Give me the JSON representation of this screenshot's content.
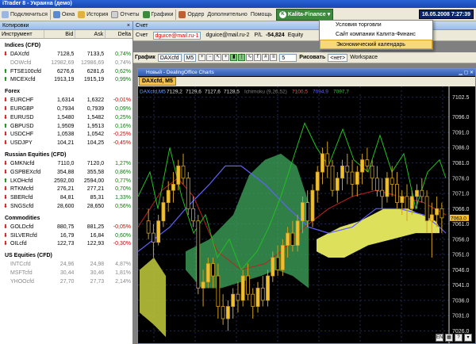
{
  "window_title": "iTrader 8 - Украина (демо)",
  "toolbar": {
    "items": [
      "Подключиться",
      "Окна",
      "История",
      "Отчеты",
      "Графики",
      "Ордер",
      "Дополнительно",
      "Помощь"
    ],
    "brand": "Kalita-Finance",
    "datetime": "16.05.2008 7:27:39"
  },
  "dropdown": {
    "items": [
      "Условия торговли",
      "Сайт компании Калита-Финанс",
      "Экономический календарь"
    ]
  },
  "quotes_panel": {
    "title": "Котировки",
    "columns": [
      "Инструмент",
      "Bid",
      "Ask",
      "Delta"
    ],
    "groups": [
      {
        "name": "Indices (CFD)",
        "rows": [
          {
            "sym": "DAXcfd",
            "bid": "7128,5",
            "ask": "7133,5",
            "delta": "0,74%",
            "dir": "up"
          },
          {
            "sym": "DOWcfd",
            "bid": "12982,69",
            "ask": "12986,69",
            "delta": "0,74%",
            "dir": "muted"
          },
          {
            "sym": "FTSE100cfd",
            "bid": "6276,6",
            "ask": "6281,6",
            "delta": "0,62%",
            "dir": "dn"
          },
          {
            "sym": "MICEXcfd",
            "bid": "1913,19",
            "ask": "1915,19",
            "delta": "0,99%",
            "dir": "dn"
          }
        ]
      },
      {
        "name": "Forex",
        "rows": [
          {
            "sym": "EURCHF",
            "bid": "1,6314",
            "ask": "1,6322",
            "delta": "-0,01%",
            "dir": "up"
          },
          {
            "sym": "EURGBP",
            "bid": "0,7934",
            "ask": "0,7939",
            "delta": "0,09%",
            "dir": "up"
          },
          {
            "sym": "EURUSD",
            "bid": "1,5480",
            "ask": "1,5482",
            "delta": "0,25%",
            "dir": "up"
          },
          {
            "sym": "GBPUSD",
            "bid": "1,9509",
            "ask": "1,9513",
            "delta": "0,16%",
            "dir": "dn"
          },
          {
            "sym": "USDCHF",
            "bid": "1,0538",
            "ask": "1,0542",
            "delta": "-0,25%",
            "dir": "up"
          },
          {
            "sym": "USDJPY",
            "bid": "104,21",
            "ask": "104,25",
            "delta": "-0,45%",
            "dir": "up"
          }
        ]
      },
      {
        "name": "Russian Equities (CFD)",
        "rows": [
          {
            "sym": "GMKNcfd",
            "bid": "7110,0",
            "ask": "7120,0",
            "delta": "1,27%",
            "dir": "up"
          },
          {
            "sym": "GSPBEXcfd",
            "bid": "354,88",
            "ask": "355,58",
            "delta": "0,86%",
            "dir": "up"
          },
          {
            "sym": "LKOHcfd",
            "bid": "2592,00",
            "ask": "2594,00",
            "delta": "0,77%",
            "dir": "dn"
          },
          {
            "sym": "RTKMcfd",
            "bid": "276,21",
            "ask": "277,21",
            "delta": "0,70%",
            "dir": "up"
          },
          {
            "sym": "SBERcfd",
            "bid": "84,81",
            "ask": "85,31",
            "delta": "1,33%",
            "dir": "up"
          },
          {
            "sym": "SNGScfd",
            "bid": "28,600",
            "ask": "28,650",
            "delta": "0,56%",
            "dir": "up"
          }
        ]
      },
      {
        "name": "Commodities",
        "rows": [
          {
            "sym": "GOLDcfd",
            "bid": "880,75",
            "ask": "881,25",
            "delta": "-0,05%",
            "dir": "up"
          },
          {
            "sym": "SILVERcfd",
            "bid": "16,79",
            "ask": "16,84",
            "delta": "0,60%",
            "dir": "up"
          },
          {
            "sym": "OILcfd",
            "bid": "122,73",
            "ask": "122,93",
            "delta": "-0,30%",
            "dir": "up"
          }
        ]
      },
      {
        "name": "US Equities (CFD)",
        "rows": [
          {
            "sym": "INTCcfd",
            "bid": "24,96",
            "ask": "24,98",
            "delta": "4,87%",
            "dir": "muted"
          },
          {
            "sym": "MSFTcfd",
            "bid": "30,44",
            "ask": "30,46",
            "delta": "1,81%",
            "dir": "muted"
          },
          {
            "sym": "YHOOcfd",
            "bid": "27,70",
            "ask": "27,73",
            "delta": "2,14%",
            "dir": "muted"
          }
        ]
      }
    ]
  },
  "account": {
    "title": "Счет",
    "label": "Счет",
    "login_a": "dguice@mail.ru-1",
    "login_b": "dguice@mail.ru-2",
    "pl_label": "P/L",
    "pl_value": "-54,824",
    "equity_label": "Equity"
  },
  "chart_toolbar": {
    "chart_label": "График",
    "symbol": "DAXcfd",
    "timeframe": "M5",
    "period": "5",
    "draw_label": "Рисовать",
    "none_option": "<нет>",
    "workspace": "Workspace"
  },
  "chart_window": {
    "title": "Новый - DealingOffice Charts",
    "tab": "DAXcfd, M5",
    "ohlc": [
      "7129,2",
      "7129,6",
      "7127,6",
      "7128,5"
    ],
    "extra": [
      "7100,5",
      "7094,9",
      "7097,7"
    ],
    "header_label": "DAXcfd,M5",
    "ichimoku_label": "Ichimoku (9,26,52)",
    "mini_icons": [
      "EN",
      "?"
    ]
  },
  "chart_data": {
    "type": "line",
    "yticks": [
      "7102.5",
      "7096.0",
      "7091.0",
      "7086.0",
      "7081.0",
      "7076.0",
      "7071.0",
      "7066.0",
      "7061.0",
      "7056.0",
      "7051.0",
      "7046.0",
      "7041.0",
      "7036.0",
      "7031.0",
      "7026.0"
    ],
    "ylim": [
      7023,
      7105
    ],
    "last_price": "7063.0",
    "candles": [
      [
        7062,
        7066,
        7056,
        7058
      ],
      [
        7058,
        7061,
        7050,
        7055
      ],
      [
        7055,
        7064,
        7054,
        7062
      ],
      [
        7062,
        7070,
        7060,
        7068
      ],
      [
        7068,
        7075,
        7065,
        7072
      ],
      [
        7072,
        7078,
        7068,
        7074
      ],
      [
        7074,
        7082,
        7072,
        7080
      ],
      [
        7080,
        7084,
        7074,
        7076
      ],
      [
        7076,
        7078,
        7064,
        7066
      ],
      [
        7066,
        7070,
        7060,
        7062
      ],
      [
        7062,
        7064,
        7038,
        7040
      ],
      [
        7040,
        7046,
        7034,
        7042
      ],
      [
        7042,
        7050,
        7040,
        7048
      ],
      [
        7048,
        7050,
        7040,
        7044
      ],
      [
        7044,
        7048,
        7030,
        7034
      ],
      [
        7034,
        7038,
        7028,
        7030
      ],
      [
        7030,
        7036,
        7026,
        7034
      ],
      [
        7034,
        7040,
        7030,
        7038
      ],
      [
        7038,
        7042,
        7032,
        7036
      ],
      [
        7036,
        7046,
        7034,
        7044
      ],
      [
        7044,
        7048,
        7036,
        7038
      ],
      [
        7038,
        7040,
        7030,
        7034
      ],
      [
        7034,
        7042,
        7032,
        7040
      ],
      [
        7040,
        7044,
        7034,
        7036
      ],
      [
        7036,
        7046,
        7034,
        7044
      ],
      [
        7044,
        7052,
        7042,
        7050
      ],
      [
        7050,
        7054,
        7044,
        7046
      ],
      [
        7046,
        7056,
        7044,
        7054
      ],
      [
        7054,
        7060,
        7050,
        7058
      ],
      [
        7058,
        7062,
        7052,
        7054
      ],
      [
        7054,
        7064,
        7052,
        7062
      ],
      [
        7062,
        7070,
        7058,
        7068
      ],
      [
        7068,
        7072,
        7060,
        7062
      ],
      [
        7062,
        7074,
        7060,
        7072
      ],
      [
        7072,
        7080,
        7068,
        7078
      ],
      [
        7078,
        7086,
        7074,
        7084
      ],
      [
        7084,
        7088,
        7076,
        7080
      ],
      [
        7080,
        7082,
        7070,
        7072
      ],
      [
        7072,
        7078,
        7068,
        7076
      ],
      [
        7076,
        7082,
        7072,
        7080
      ],
      [
        7080,
        7084,
        7074,
        7078
      ],
      [
        7078,
        7082,
        7070,
        7074
      ],
      [
        7074,
        7080,
        7070,
        7078
      ],
      [
        7078,
        7084,
        7074,
        7082
      ],
      [
        7082,
        7086,
        7078,
        7080
      ],
      [
        7080,
        7082,
        7072,
        7076
      ],
      [
        7076,
        7080,
        7070,
        7072
      ],
      [
        7072,
        7076,
        7066,
        7070
      ],
      [
        7070,
        7078,
        7068,
        7076
      ],
      [
        7076,
        7080,
        7070,
        7074
      ],
      [
        7074,
        7078,
        7066,
        7068
      ],
      [
        7068,
        7072,
        7064,
        7070
      ],
      [
        7070,
        7074,
        7062,
        7066
      ],
      [
        7066,
        7072,
        7064,
        7070
      ],
      [
        7070,
        7074,
        7066,
        7072
      ],
      [
        7072,
        7076,
        7068,
        7070
      ],
      [
        7070,
        7072,
        7058,
        7062
      ],
      [
        7062,
        7068,
        7050,
        7064
      ],
      [
        7064,
        7070,
        7060,
        7066
      ],
      [
        7066,
        7068,
        7058,
        7063
      ]
    ]
  }
}
